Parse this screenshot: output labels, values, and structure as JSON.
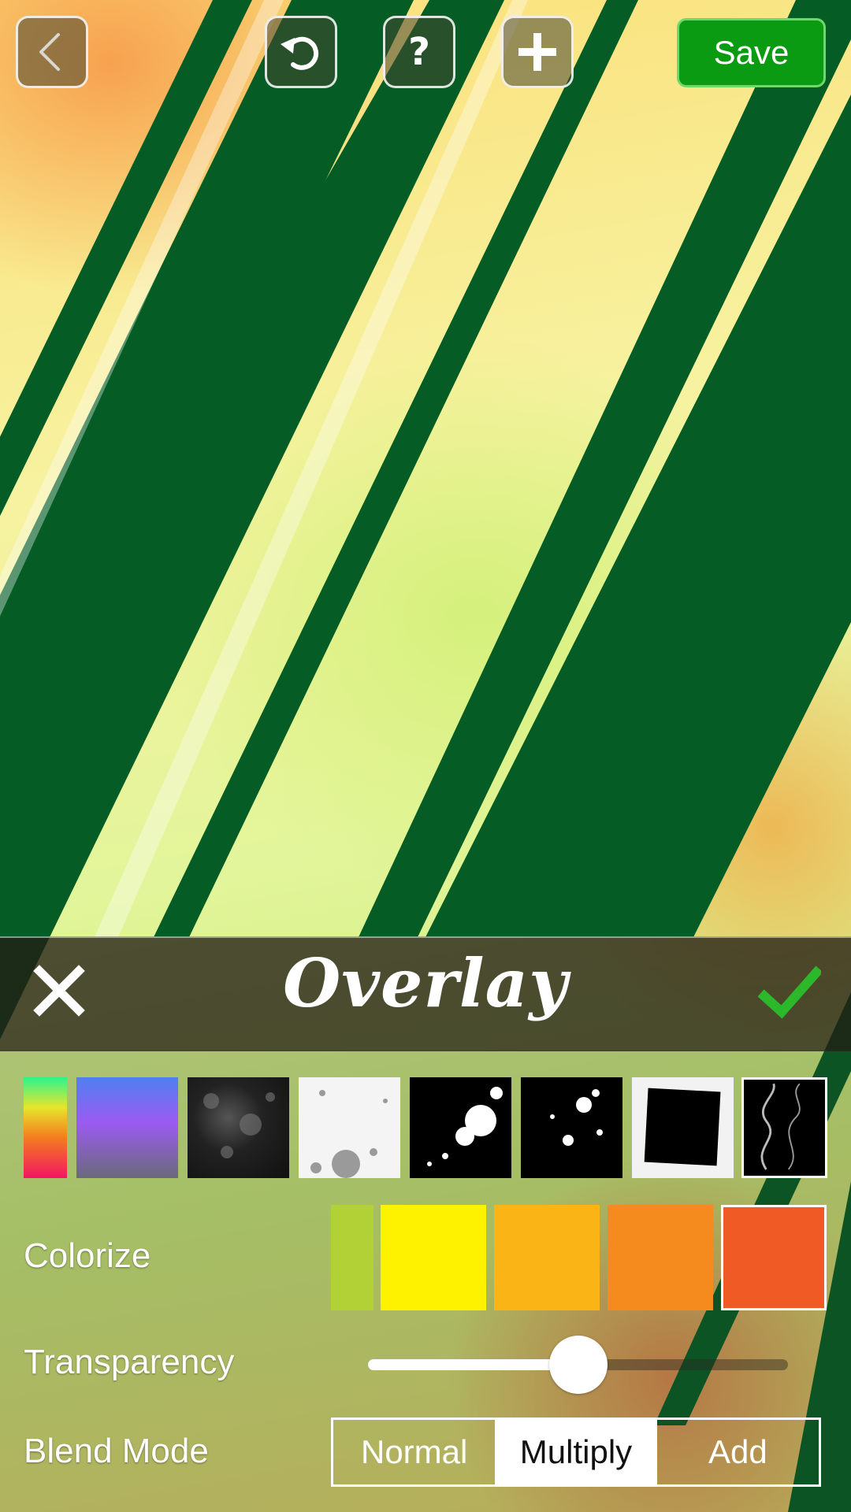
{
  "toolbar": {
    "back_icon": "chevron-left-icon",
    "undo_icon": "undo-icon",
    "help_icon": "question-icon",
    "add_icon": "plus-icon",
    "save_label": "Save",
    "save_color": "#0a9b12"
  },
  "panel": {
    "title": "Overlay",
    "close_icon": "close-icon",
    "confirm_icon": "check-icon",
    "confirm_color": "#2bb82b",
    "textures": [
      {
        "name": "rainbow-gradient"
      },
      {
        "name": "blue-purple-gradient"
      },
      {
        "name": "dark-grunge"
      },
      {
        "name": "white-splatter"
      },
      {
        "name": "black-splatter"
      },
      {
        "name": "black-speckle"
      },
      {
        "name": "dark-frame"
      },
      {
        "name": "smoke",
        "selected": true
      }
    ],
    "colorize": {
      "label": "Colorize",
      "colors": [
        "#b1d136",
        "#fff200",
        "#fbb415",
        "#f58a1f",
        "#f05a25"
      ],
      "selected_index": 4
    },
    "transparency": {
      "label": "Transparency",
      "value": 0.5
    },
    "blend_mode": {
      "label": "Blend Mode",
      "options": [
        "Normal",
        "Multiply",
        "Add"
      ],
      "selected": "Multiply"
    }
  }
}
